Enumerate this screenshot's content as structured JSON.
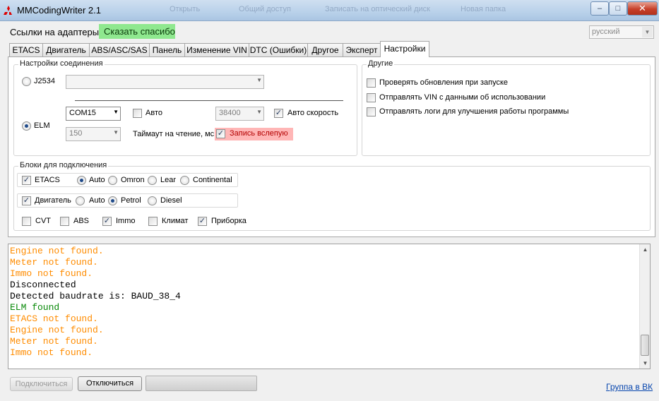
{
  "window": {
    "title": "MMCodingWriter 2.1"
  },
  "background_taskbar": [
    "Открыть",
    "Общий доступ",
    "Записать на оптический диск",
    "Новая папка"
  ],
  "top": {
    "adapters_link": "Ссылки на адаптеры",
    "thanks_button": "Сказать спасибо",
    "language": "русский"
  },
  "tabs": [
    {
      "label": "ETACS"
    },
    {
      "label": "Двигатель"
    },
    {
      "label": "ABS/ASC/SAS"
    },
    {
      "label": "Панель"
    },
    {
      "label": "Изменение VIN"
    },
    {
      "label": "DTC (Ошибки)"
    },
    {
      "label": "Другое"
    },
    {
      "label": "Эксперт"
    },
    {
      "label": "Настройки",
      "active": true
    }
  ],
  "connection": {
    "legend": "Настройки соединения",
    "j2534_label": "J2534",
    "j2534_selected": false,
    "j2534_device": "",
    "elm_label": "ELM",
    "elm_selected": true,
    "port": "COM15",
    "auto_label": "Авто",
    "auto_checked": false,
    "baud": "38400",
    "auto_speed_label": "Авто скорость",
    "auto_speed_checked": true,
    "timeout_value": "150",
    "timeout_label": "Таймаут на чтение, мс",
    "blind_write_label": "Запись вслепую",
    "blind_write_checked": true
  },
  "other": {
    "legend": "Другие",
    "options": [
      {
        "label": "Проверять обновления при запуске",
        "checked": false
      },
      {
        "label": "Отправлять VIN с данными об использовании",
        "checked": false
      },
      {
        "label": "Отправлять логи для улучшения работы программы",
        "checked": false
      }
    ]
  },
  "blocks": {
    "legend": "Блоки для подключения",
    "etacs": {
      "label": "ETACS",
      "checked": true,
      "options": [
        "Auto",
        "Omron",
        "Lear",
        "Continental"
      ],
      "selected": "Auto"
    },
    "engine": {
      "label": "Двигатель",
      "checked": true,
      "options": [
        "Auto",
        "Petrol",
        "Diesel"
      ],
      "selected": "Petrol"
    },
    "others": [
      {
        "label": "CVT",
        "checked": false
      },
      {
        "label": "ABS",
        "checked": false
      },
      {
        "label": "Immo",
        "checked": true
      },
      {
        "label": "Климат",
        "checked": false
      },
      {
        "label": "Приборка",
        "checked": true
      }
    ]
  },
  "log": [
    {
      "text": "Engine not found.",
      "color": "#ff8c00"
    },
    {
      "text": "Meter not found.",
      "color": "#ff8c00"
    },
    {
      "text": "Immo not found.",
      "color": "#ff8c00"
    },
    {
      "text": "Disconnected",
      "color": "#000000"
    },
    {
      "text": "Detected baudrate is: BAUD_38_4",
      "color": "#000000"
    },
    {
      "text": "ELM found",
      "color": "#0a8a0a"
    },
    {
      "text": "ETACS not found.",
      "color": "#ff8c00"
    },
    {
      "text": "Engine not found.",
      "color": "#ff8c00"
    },
    {
      "text": "Meter not found.",
      "color": "#ff8c00"
    },
    {
      "text": "Immo not found.",
      "color": "#ff8c00"
    }
  ],
  "bottom": {
    "connect_button": "Подключиться",
    "disconnect_button": "Отключиться",
    "vk_link": "Группа в ВК"
  }
}
